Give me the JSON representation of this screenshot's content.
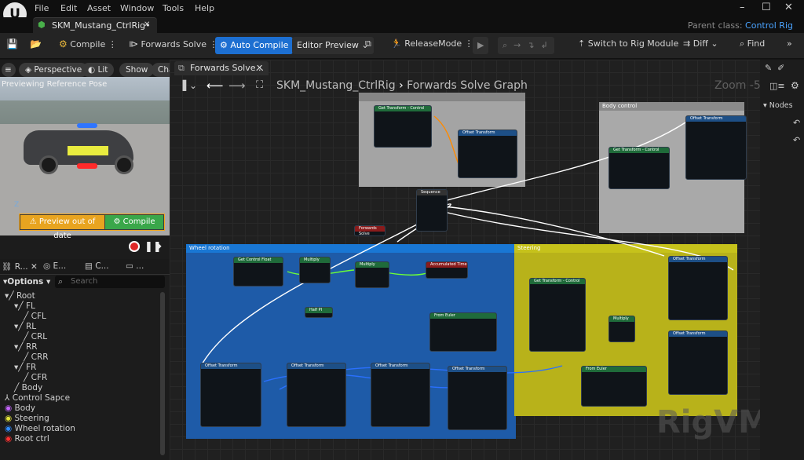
{
  "app": {
    "menu": [
      "File",
      "Edit",
      "Asset",
      "Window",
      "Tools",
      "Help"
    ],
    "doc_tab": "SKM_Mustang_CtrlRig•",
    "parent_class_label": "Parent class:",
    "parent_class_value": "Control Rig"
  },
  "toolbar": {
    "compile": "Compile",
    "forwards_solve": "Forwards Solve",
    "auto_compile": "Auto Compile",
    "editor_preview": "Editor Preview",
    "release_mode": "ReleaseMode",
    "switch_rig_module": "Switch to Rig Module",
    "diff": "Diff",
    "find": "Find",
    "accent": "#1d6fd1"
  },
  "viewport": {
    "perspective": "Perspective",
    "lit": "Lit",
    "show": "Show",
    "cha": "Cha",
    "previewing": "Previewing Reference Pose",
    "preview_out_of_date": "Preview out of date",
    "compile": "Compile"
  },
  "panel_tabs": [
    "R...",
    "E...",
    "C...",
    "..."
  ],
  "hierarchy": {
    "options": "Options",
    "search_placeholder": "Search",
    "items": [
      "Root",
      "FL",
      "CFL",
      "RL",
      "CRL",
      "RR",
      "CRR",
      "FR",
      "CFR",
      "Body",
      "Control Sapce",
      "Body",
      "Steering",
      "Wheel rotation",
      "Root ctrl"
    ]
  },
  "graph": {
    "tab": "Forwards Solve...",
    "breadcrumb_root": "SKM_Mustang_CtrlRig",
    "breadcrumb_leaf": "Forwards Solve Graph",
    "zoom": "Zoom -5",
    "watermark": "RigVM",
    "comments": [
      "Body control",
      "Wheel rotation",
      "Steering"
    ],
    "nodes": {
      "get_transform": "Get Transform - Control",
      "offset_transform": "Offset Transform",
      "sequence": "Sequence",
      "forwards_solve": "Forwards Solve",
      "get_control_float": "Get Control Float",
      "multiply": "Multiply",
      "accumulated_time": "Accumulated Time",
      "half_pi": "Half PI",
      "from_euler": "From Euler"
    }
  },
  "details": {
    "nodes_header": "Nodes"
  }
}
